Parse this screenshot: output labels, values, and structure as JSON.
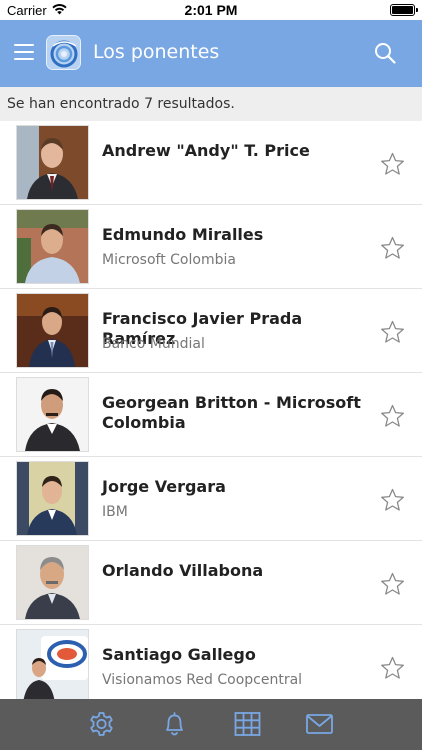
{
  "status_bar": {
    "carrier": "Carrier",
    "time": "2:01 PM",
    "wifi_icon": "wifi-icon",
    "battery_icon": "battery-icon"
  },
  "header": {
    "title": "Los ponentes",
    "menu_icon": "hamburger-menu-icon",
    "logo_icon": "app-logo-icon",
    "search_icon": "search-icon",
    "background_color": "#79a7e3"
  },
  "results": {
    "text": "Se han encontrado 7 resultados."
  },
  "speakers": [
    {
      "name": "Andrew \"Andy\" T. Price",
      "organization": "",
      "favorite": false
    },
    {
      "name": "Edmundo Miralles",
      "organization": "Microsoft Colombia",
      "favorite": false
    },
    {
      "name": "Francisco Javier Prada Ramírez",
      "organization": "Banco Mundial",
      "favorite": false
    },
    {
      "name": "Georgean Britton - Microsoft Colombia",
      "organization": "",
      "favorite": false
    },
    {
      "name": "Jorge Vergara",
      "organization": "IBM",
      "favorite": false
    },
    {
      "name": "Orlando Villabona",
      "organization": "",
      "favorite": false
    },
    {
      "name": "Santiago Gallego",
      "organization": "Visionamos Red Coopcentral",
      "favorite": false
    }
  ],
  "tab_bar": {
    "background_color": "#5b5b5b",
    "icon_color": "#79a7e3",
    "tabs": [
      {
        "icon": "gear-icon"
      },
      {
        "icon": "bell-icon"
      },
      {
        "icon": "grid-icon"
      },
      {
        "icon": "envelope-icon"
      }
    ]
  }
}
